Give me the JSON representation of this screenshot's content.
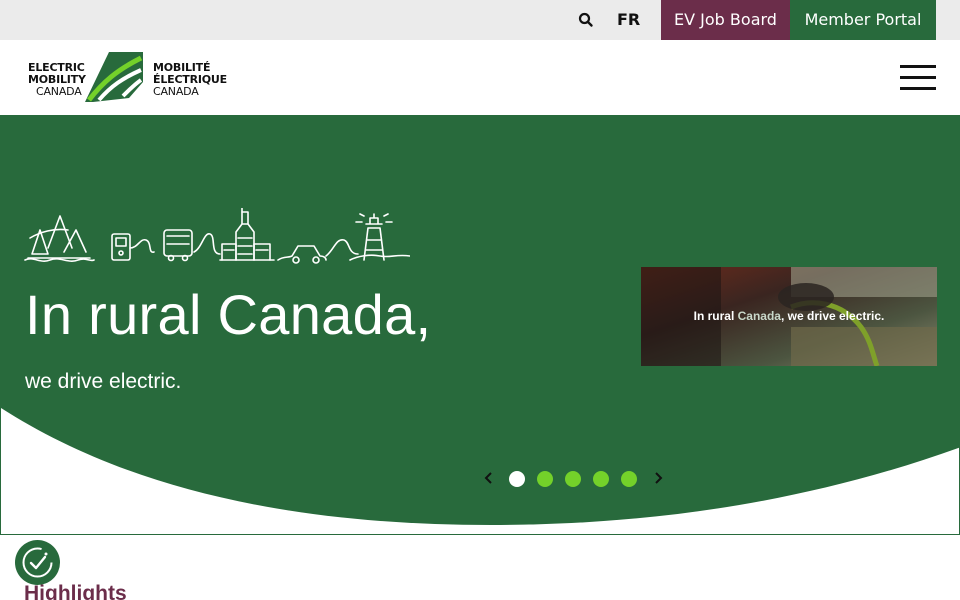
{
  "topbar": {
    "search_icon": "search-icon",
    "language": "FR",
    "job_board": "EV Job Board",
    "member_portal": "Member Portal",
    "colors": {
      "job_board_bg": "#6b2d4a",
      "member_portal_bg": "#286a3c",
      "bar_bg": "#ebebeb"
    }
  },
  "header": {
    "logo": {
      "left_lines": [
        "ELECTRIC",
        "MOBILITY",
        "CANADA"
      ],
      "right_lines": [
        "MOBILITÉ",
        "ÉLECTRIQUE",
        "CANADA"
      ]
    },
    "menu_icon": "hamburger-icon"
  },
  "hero": {
    "title": "In rural Canada,",
    "subtitle": "we drive electric.",
    "thumbnail": {
      "caption_part1": "In rural ",
      "caption_accent": "Canada",
      "caption_part2": ", we drive electric."
    },
    "carousel": {
      "slide_count": 5,
      "active_slide": 1,
      "prev_icon": "chevron-left-icon",
      "next_icon": "chevron-right-icon"
    },
    "colors": {
      "hero_bg": "#286a3c",
      "dot_inactive": "#74d12a",
      "dot_active": "#ffffff"
    }
  },
  "accessibility": {
    "icon": "accessibility-icon"
  },
  "section": {
    "heading": "Highlights",
    "color": "#6b2d4a"
  }
}
